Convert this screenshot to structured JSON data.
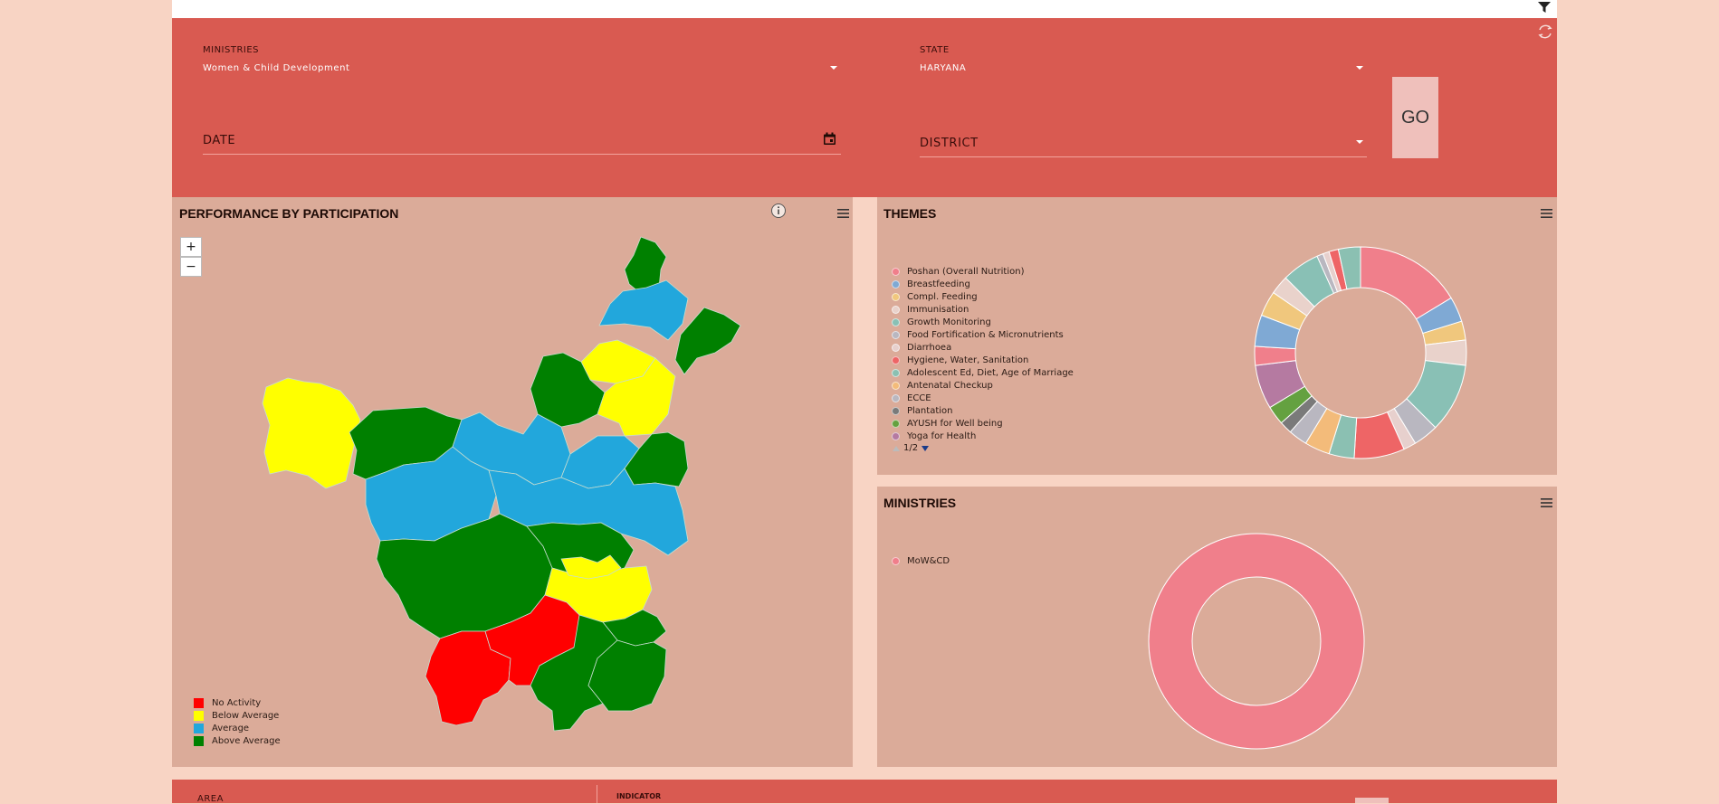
{
  "filters": {
    "ministries_label": "MINISTRIES",
    "ministries_value": "Women & Child Development",
    "state_label": "STATE",
    "state_value": "HARYANA",
    "date_placeholder": "DATE",
    "district_placeholder": "DISTRICT",
    "go_label": "GO"
  },
  "participation": {
    "title": "PERFORMANCE BY PARTICIPATION",
    "zoom_in": "+",
    "zoom_out": "−",
    "legend": [
      {
        "label": "No Activity",
        "color": "#ff0000"
      },
      {
        "label": "Below Average",
        "color": "#ffff00"
      },
      {
        "label": "Average",
        "color": "#22a7dc"
      },
      {
        "label": "Above Average",
        "color": "#008000"
      }
    ]
  },
  "themes": {
    "title": "THEMES",
    "pager": "1/2",
    "legend": [
      {
        "label": "Poshan (Overall Nutrition)",
        "color": "#f07f8b"
      },
      {
        "label": "Breastfeeding",
        "color": "#7fa9d4"
      },
      {
        "label": "Compl. Feeding",
        "color": "#f0c77d"
      },
      {
        "label": "Immunisation",
        "color": "#e9d2cb"
      },
      {
        "label": "Growth Monitoring",
        "color": "#89c0b5"
      },
      {
        "label": "Food Fortification & Micronutrients",
        "color": "#b9b7c0"
      },
      {
        "label": "Diarrhoea",
        "color": "#e7d0cd"
      },
      {
        "label": "Hygiene, Water, Sanitation",
        "color": "#ee6566"
      },
      {
        "label": "Adolescent Ed, Diet, Age of Marriage",
        "color": "#8bc0b2"
      },
      {
        "label": "Antenatal Checkup",
        "color": "#f3bb7a"
      },
      {
        "label": "ECCE",
        "color": "#b9b7c0"
      },
      {
        "label": "Plantation",
        "color": "#7a7a7a"
      },
      {
        "label": "AYUSH for Well being",
        "color": "#64a140"
      },
      {
        "label": "Yoga for Health",
        "color": "#b57aa1"
      }
    ],
    "chart_data": {
      "type": "pie",
      "donut": true,
      "slices": [
        {
          "label": "Poshan (Overall Nutrition)",
          "value": 17,
          "color": "#f07f8b"
        },
        {
          "label": "Breastfeeding",
          "value": 4,
          "color": "#7fa9d4"
        },
        {
          "label": "Compl. Feeding",
          "value": 3,
          "color": "#f0c77d"
        },
        {
          "label": "Immunisation",
          "value": 4,
          "color": "#e9d2cb"
        },
        {
          "label": "Growth Monitoring",
          "value": 11,
          "color": "#89c0b5"
        },
        {
          "label": "Food Fortification & Micronutrients",
          "value": 4,
          "color": "#b9b7c0"
        },
        {
          "label": "Diarrhoea",
          "value": 2,
          "color": "#e7d0cd"
        },
        {
          "label": "Hygiene, Water, Sanitation",
          "value": 8,
          "color": "#ee6566"
        },
        {
          "label": "Adolescent Ed, Diet, Age of Marriage",
          "value": 4,
          "color": "#8bc0b2"
        },
        {
          "label": "Antenatal Checkup",
          "value": 4,
          "color": "#f3bb7a"
        },
        {
          "label": "ECCE",
          "value": 3,
          "color": "#b9b7c0"
        },
        {
          "label": "Plantation",
          "value": 2,
          "color": "#7a7a7a"
        },
        {
          "label": "AYUSH for Well being",
          "value": 3,
          "color": "#64a140"
        },
        {
          "label": "Yoga for Health",
          "value": 7,
          "color": "#b57aa1"
        },
        {
          "label": "",
          "value": 3,
          "color": "#f07f8b"
        },
        {
          "label": "",
          "value": 5,
          "color": "#7fa9d4"
        },
        {
          "label": "",
          "value": 4,
          "color": "#f0c77d"
        },
        {
          "label": "",
          "value": 3,
          "color": "#e9d2cb"
        },
        {
          "label": "",
          "value": 6,
          "color": "#89c0b5"
        },
        {
          "label": "",
          "value": 1,
          "color": "#b9b7c0"
        },
        {
          "label": "",
          "value": 1,
          "color": "#e7d0cd"
        },
        {
          "label": "",
          "value": 1.5,
          "color": "#ee6566"
        },
        {
          "label": "",
          "value": 3.5,
          "color": "#8bc0b2"
        }
      ]
    }
  },
  "ministries_card": {
    "title": "MINISTRIES",
    "legend": [
      {
        "label": "MoW&CD",
        "color": "#f07f8b"
      }
    ],
    "chart_data": {
      "type": "pie",
      "donut": true,
      "slices": [
        {
          "label": "MoW&CD",
          "value": 100,
          "color": "#f07f8b"
        }
      ]
    }
  },
  "bottom": {
    "area_label": "AREA",
    "indicator_label": "INDICATOR"
  }
}
